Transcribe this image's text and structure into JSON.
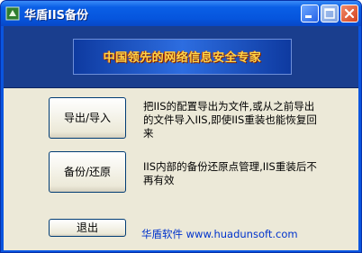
{
  "window": {
    "title": "华盾IIS备份",
    "controls": [
      "minimize",
      "maximize",
      "close"
    ],
    "app_icon": "app-icon"
  },
  "banner": {
    "text": "中国领先的网络信息安全专家"
  },
  "actions": {
    "export_label": "导出/导入",
    "export_desc": "把IIS的配置导出为文件,或从之前导出的文件导入IIS,即使IIS重装也能恢复回来",
    "backup_label": "备份/还原",
    "backup_desc": "IIS内部的备份还原点管理,IIS重装后不再有效",
    "exit_label": "退出"
  },
  "footer": {
    "website": "华盾软件 www.huadunsoft.com"
  },
  "colors": {
    "titlebar": "#0a5fe6",
    "header_band": "#1a3e8e",
    "banner_text": "#ffd54a",
    "face": "#ece9d8",
    "link": "#0033cc"
  }
}
